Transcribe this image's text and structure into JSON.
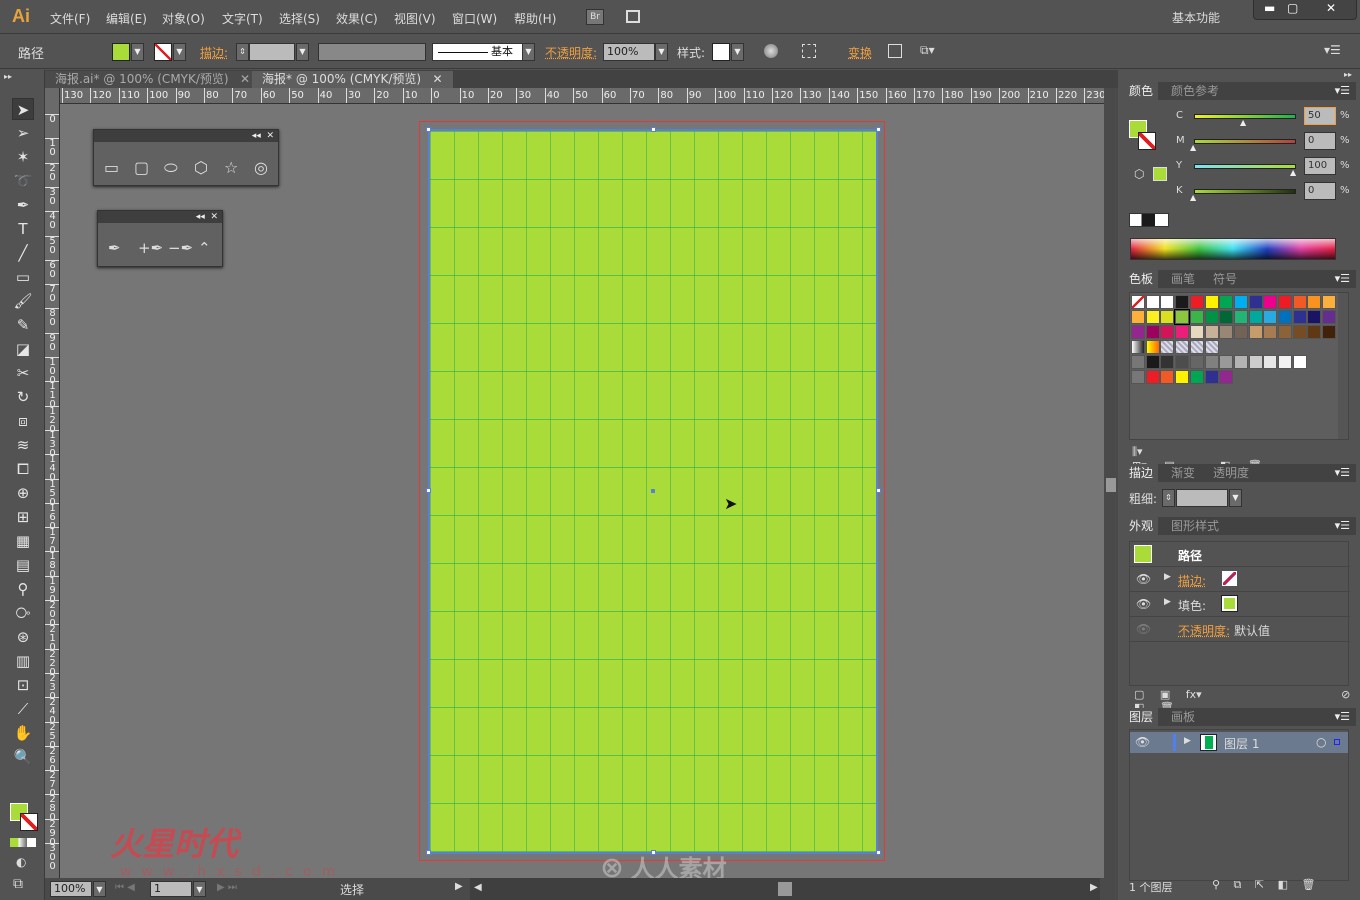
{
  "app": {
    "logo": "Ai",
    "workspace": "基本功能",
    "bridge": "Br",
    "window_controls": [
      "minimize",
      "maximize",
      "close"
    ]
  },
  "menu": [
    "文件(F)",
    "编辑(E)",
    "对象(O)",
    "文字(T)",
    "选择(S)",
    "效果(C)",
    "视图(V)",
    "窗口(W)",
    "帮助(H)"
  ],
  "control": {
    "selection_type": "路径",
    "fill_color": "#a9dc38",
    "stroke_label": "描边:",
    "stroke_profile": "基本",
    "opacity_label": "不透明度:",
    "opacity": "100%",
    "style_label": "样式:",
    "transform_label": "变换"
  },
  "tabs": [
    {
      "label": "海报.ai* @ 100% (CMYK/预览)",
      "active": false
    },
    {
      "label": "海报* @ 100% (CMYK/预览)",
      "active": true
    }
  ],
  "ruler_h": [
    "130",
    "120",
    "110",
    "100",
    "90",
    "80",
    "70",
    "60",
    "50",
    "40",
    "30",
    "20",
    "10",
    "0",
    "10",
    "20",
    "30",
    "40",
    "50",
    "60",
    "70",
    "80",
    "90",
    "100",
    "110",
    "120",
    "130",
    "140",
    "150",
    "160",
    "170",
    "180",
    "190",
    "200",
    "210",
    "220",
    "230"
  ],
  "ruler_v": [
    "0",
    "10",
    "20",
    "30",
    "40",
    "50",
    "60",
    "70",
    "80",
    "90",
    "100",
    "110",
    "120",
    "130",
    "140",
    "150",
    "160",
    "170",
    "180",
    "190",
    "200",
    "210",
    "220",
    "230",
    "240",
    "250",
    "260",
    "270",
    "280",
    "290",
    "300"
  ],
  "artboard": {
    "fill": "#a9dc38",
    "grid": "#2ea65a",
    "bleed": "#e23a3a",
    "selection": "#5a7fd8"
  },
  "tools": [
    "selection",
    "direct-selection",
    "magic-wand",
    "lasso",
    "pen",
    "type",
    "line",
    "rectangle",
    "paintbrush",
    "pencil",
    "blob-brush",
    "scissors",
    "rotate",
    "scale",
    "warp",
    "free-transform",
    "shape-builder",
    "perspective",
    "mesh",
    "gradient",
    "eyedropper",
    "blend",
    "symbol-sprayer",
    "column-graph",
    "artboard",
    "slice",
    "hand",
    "zoom"
  ],
  "float_panels": {
    "shapes": [
      "rectangle",
      "rounded-rectangle",
      "ellipse",
      "polygon",
      "star",
      "flare"
    ],
    "pens": [
      "pen",
      "add-anchor",
      "delete-anchor",
      "convert-anchor"
    ]
  },
  "status": {
    "zoom": "100%",
    "artboard": "1",
    "tool": "选择"
  },
  "color_panel": {
    "tabs": [
      "颜色",
      "颜色参考"
    ],
    "channels": [
      {
        "label": "C",
        "value": "50"
      },
      {
        "label": "M",
        "value": "0"
      },
      {
        "label": "Y",
        "value": "100"
      },
      {
        "label": "K",
        "value": "0"
      }
    ],
    "unit": "%"
  },
  "swatches_panel": {
    "tabs": [
      "色板",
      "画笔",
      "符号"
    ],
    "rows": [
      [
        "none",
        "reg",
        "#ffffff",
        "#1a1a1a",
        "#ee1c25",
        "#fff200",
        "#00a651",
        "#00aeef",
        "#2e3192",
        "#ec008c",
        "#ed1c24",
        "#f15a24",
        "#f7931e",
        "#fbb03b"
      ],
      [
        "#fbb03b",
        "#fcee21",
        "#d9e021",
        "#8cc63f",
        "#39b54a",
        "#009245",
        "#006837",
        "#22b573",
        "#00a99d",
        "#29abe2",
        "#0071bc",
        "#2e3192",
        "#1b1464",
        "#662d91"
      ],
      [
        "#93278f",
        "#9e005d",
        "#d4145a",
        "#ed1e79",
        "#e6d7bf",
        "#c7b299",
        "#998675",
        "#736357",
        "#c69c6d",
        "#a67c52",
        "#8c6239",
        "#754c24",
        "#603813",
        "#42210b"
      ],
      [
        "grad-bw",
        "grad-yo",
        "pattern",
        "pattern2",
        "pattern3",
        "pattern4"
      ],
      [
        "folder",
        "#1a1a1a",
        "#333333",
        "#4d4d4d",
        "#666666",
        "#808080",
        "#999999",
        "#b3b3b3",
        "#cccccc",
        "#e6e6e6",
        "#f2f2f2",
        "#ffffff"
      ],
      [
        "folder",
        "#ee1c25",
        "#f15a24",
        "#fff200",
        "#00a651",
        "#2e3192",
        "#92278f"
      ]
    ]
  },
  "stroke_panel": {
    "tabs": [
      "描边",
      "渐变",
      "透明度"
    ],
    "weight_label": "粗细:"
  },
  "appearance_panel": {
    "tabs": [
      "外观",
      "图形样式"
    ],
    "title": "路径",
    "rows": [
      {
        "label": "描边:",
        "type": "stroke"
      },
      {
        "label": "填色:",
        "type": "fill"
      },
      {
        "label": "不透明度:",
        "value": "默认值"
      }
    ]
  },
  "layers_panel": {
    "tabs": [
      "图层",
      "画板"
    ],
    "layers": [
      {
        "name": "图层 1",
        "color": "#00b050"
      }
    ],
    "count": "1 个图层"
  },
  "watermarks": [
    "火星时代",
    "www.hxsd.com",
    "人人素材"
  ]
}
